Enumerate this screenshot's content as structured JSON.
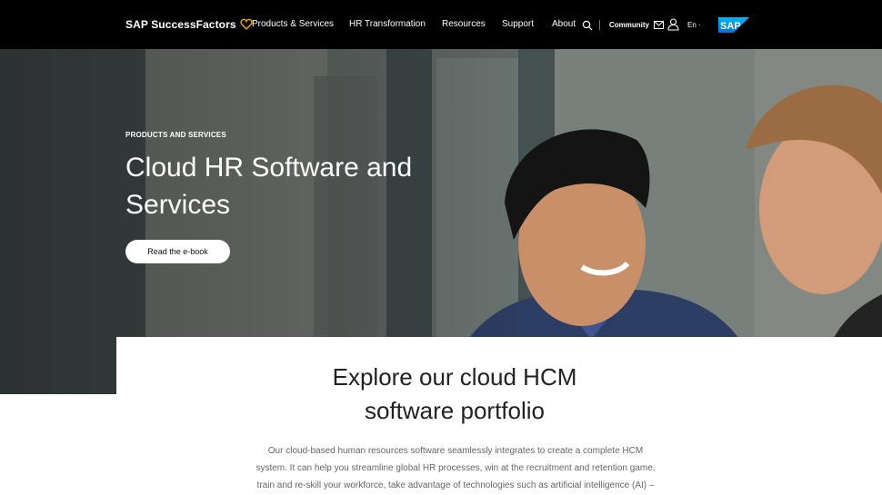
{
  "nav": {
    "brand": "SAP SuccessFactors",
    "items": [
      "Products & Services",
      "HR Transformation",
      "Resources",
      "Support",
      "About"
    ],
    "community": "Community",
    "language": "En ·",
    "sap_logo": "SAP",
    "icons": [
      "heart-icon",
      "search-icon",
      "mail-icon",
      "user-icon",
      "sap-logo"
    ]
  },
  "hero": {
    "eyebrow": "PRODUCTS AND SERVICES",
    "title_line1": "Cloud HR Software and",
    "title_line2": "Services",
    "cta": "Read the e-book"
  },
  "section": {
    "title_line1": "Explore our cloud HCM",
    "title_line2": "software portfolio",
    "body_line1": "Our cloud-based human resources software seamlessly integrates to create a complete HCM",
    "body_line2": "system. It can help you streamline global HR processes, win at the recruitment and retention game,",
    "body_line3": "train and re-skill your workforce, take advantage of technologies such as artificial intelligence (AI) –"
  },
  "colors": {
    "nav_bg": "#000000",
    "heart": "#f0ab00",
    "sap_blue": "#0a6ed1"
  }
}
